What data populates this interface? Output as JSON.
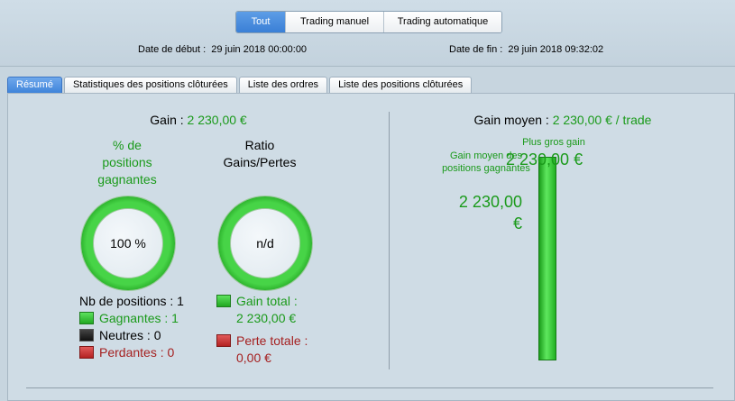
{
  "filters": {
    "items": [
      {
        "label": "Tout",
        "active": true
      },
      {
        "label": "Trading manuel",
        "active": false
      },
      {
        "label": "Trading automatique",
        "active": false
      }
    ]
  },
  "dates": {
    "start_label": "Date de début :",
    "start_value": "29 juin 2018 00:00:00",
    "end_label": "Date de fin :",
    "end_value": "29 juin 2018 09:32:02"
  },
  "tabs": [
    {
      "label": "Résumé",
      "active": true
    },
    {
      "label": "Statistiques des positions clôturées",
      "active": false
    },
    {
      "label": "Liste des ordres",
      "active": false
    },
    {
      "label": "Liste des positions clôturées",
      "active": false
    }
  ],
  "summary": {
    "gain_label": "Gain :",
    "gain_value": "2 230,00 €",
    "win_rate_title": "% de positions gagnantes",
    "win_rate_value": "100 %",
    "ratio_title": "Ratio Gains/Pertes",
    "ratio_value": "n/d",
    "positions_label": "Nb de positions : 1",
    "winning_label": "Gagnantes : 1",
    "neutral_label": "Neutres : 0",
    "losing_label": "Perdantes : 0",
    "total_gain_label": "Gain total :",
    "total_gain_value": "2 230,00 €",
    "total_loss_label": "Perte totale :",
    "total_loss_value": "0,00 €"
  },
  "average": {
    "label": "Gain moyen :",
    "value": "2 230,00 € / trade",
    "avg_win_label": "Gain moyen des positions gagnantes",
    "avg_win_value": "2 230,00 €",
    "max_gain_label": "Plus gros gain",
    "max_gain_value": "2 230,00 €",
    "bar_level": 1.0
  },
  "colors": {
    "accent_blue": "#3a7fd6",
    "positive_green": "#1a9a1a",
    "negative_red": "#a52020"
  }
}
